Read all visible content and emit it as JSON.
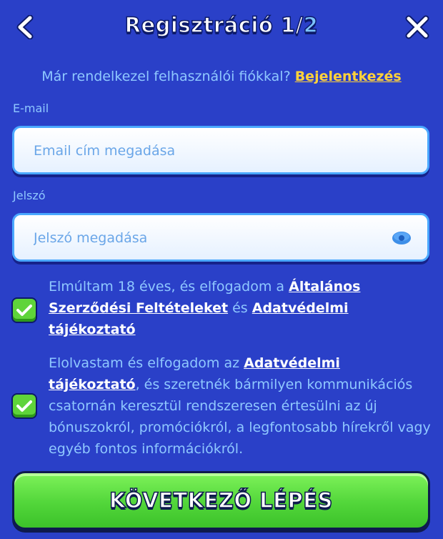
{
  "header": {
    "title_prefix": "Regisztráció 1/",
    "title_total": "2"
  },
  "login_prompt": {
    "text": "Már rendelkezel felhasználói fiókkal? ",
    "link_label": "Bejelentkezés"
  },
  "email": {
    "label": "E-mail",
    "placeholder": "Email cím megadása",
    "value": ""
  },
  "password": {
    "label": "Jelszó",
    "placeholder": "Jelszó megadása",
    "value": ""
  },
  "consents": [
    {
      "checked": true,
      "part1": "Elmúltam 18 éves, és elfogadom a ",
      "link1": "Általános Szerződési Feltételeket",
      "part2": " és ",
      "link2": "Adatvédelmi tájékoztató"
    },
    {
      "checked": true,
      "part1": "Elolvastam és elfogadom az ",
      "link1": "Adatvédelmi tájékoztató",
      "part2": ", és szeretnék bármilyen kommunikációs csatornán keresztül rendszeresen értesülni az új bónuszokról, promóciókról, a legfontosabb hírekről vagy egyéb fontos információkról."
    }
  ],
  "next_button": {
    "label": "KÖVETKEZŐ LÉPÉS"
  },
  "icons": {
    "back": "chevron-left-icon",
    "close": "close-icon",
    "eye": "eye-icon",
    "check": "checkmark-icon"
  },
  "colors": {
    "background": "#2a40c8",
    "text": "#8fc8ff",
    "link_login": "#ffd23a",
    "checkbox": "#5fd43a",
    "button": "#52d63a"
  }
}
